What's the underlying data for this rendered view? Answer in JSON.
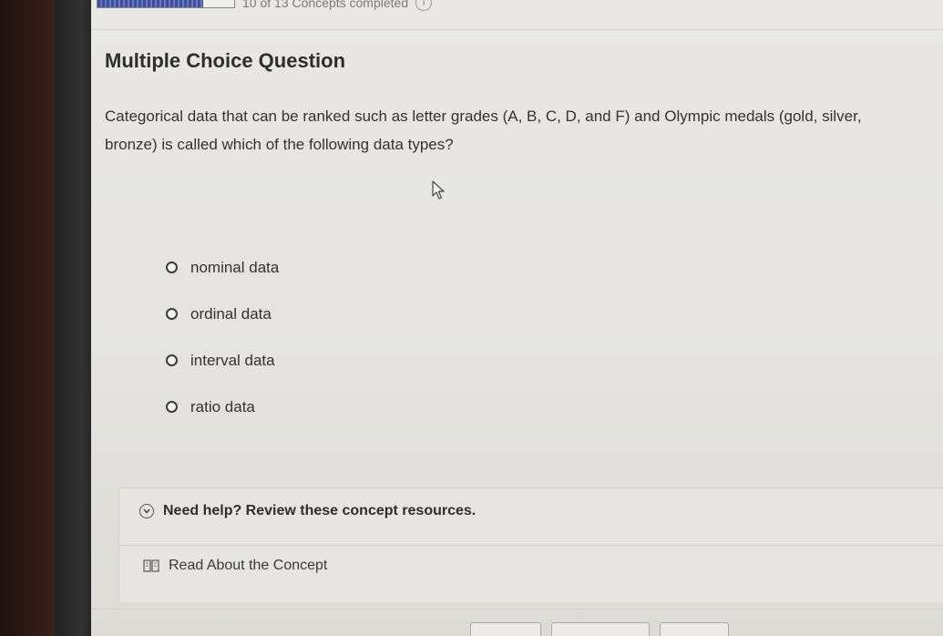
{
  "progress": {
    "label": "10 of 13 Concepts completed",
    "fraction": 0.77,
    "info_symbol": "i"
  },
  "question": {
    "heading": "Multiple Choice Question",
    "text": "Categorical data that can be ranked such as letter grades (A, B, C, D, and F) and Olympic medals (gold, silver, bronze) is called which of the following data types?",
    "options": [
      {
        "label": "nominal data"
      },
      {
        "label": "ordinal data"
      },
      {
        "label": "interval data"
      },
      {
        "label": "ratio data"
      }
    ]
  },
  "help": {
    "header": "Need help? Review these concept resources.",
    "resource_link": "Read About the Concept"
  },
  "colors": {
    "screen_bg": "#e6e5e1",
    "text": "#333333",
    "progress_fill": "#3f4fa0"
  },
  "icons": {
    "chevron": "chevron-down-icon",
    "book": "book-icon",
    "cursor": "mouse-pointer-icon",
    "info": "info-icon"
  }
}
